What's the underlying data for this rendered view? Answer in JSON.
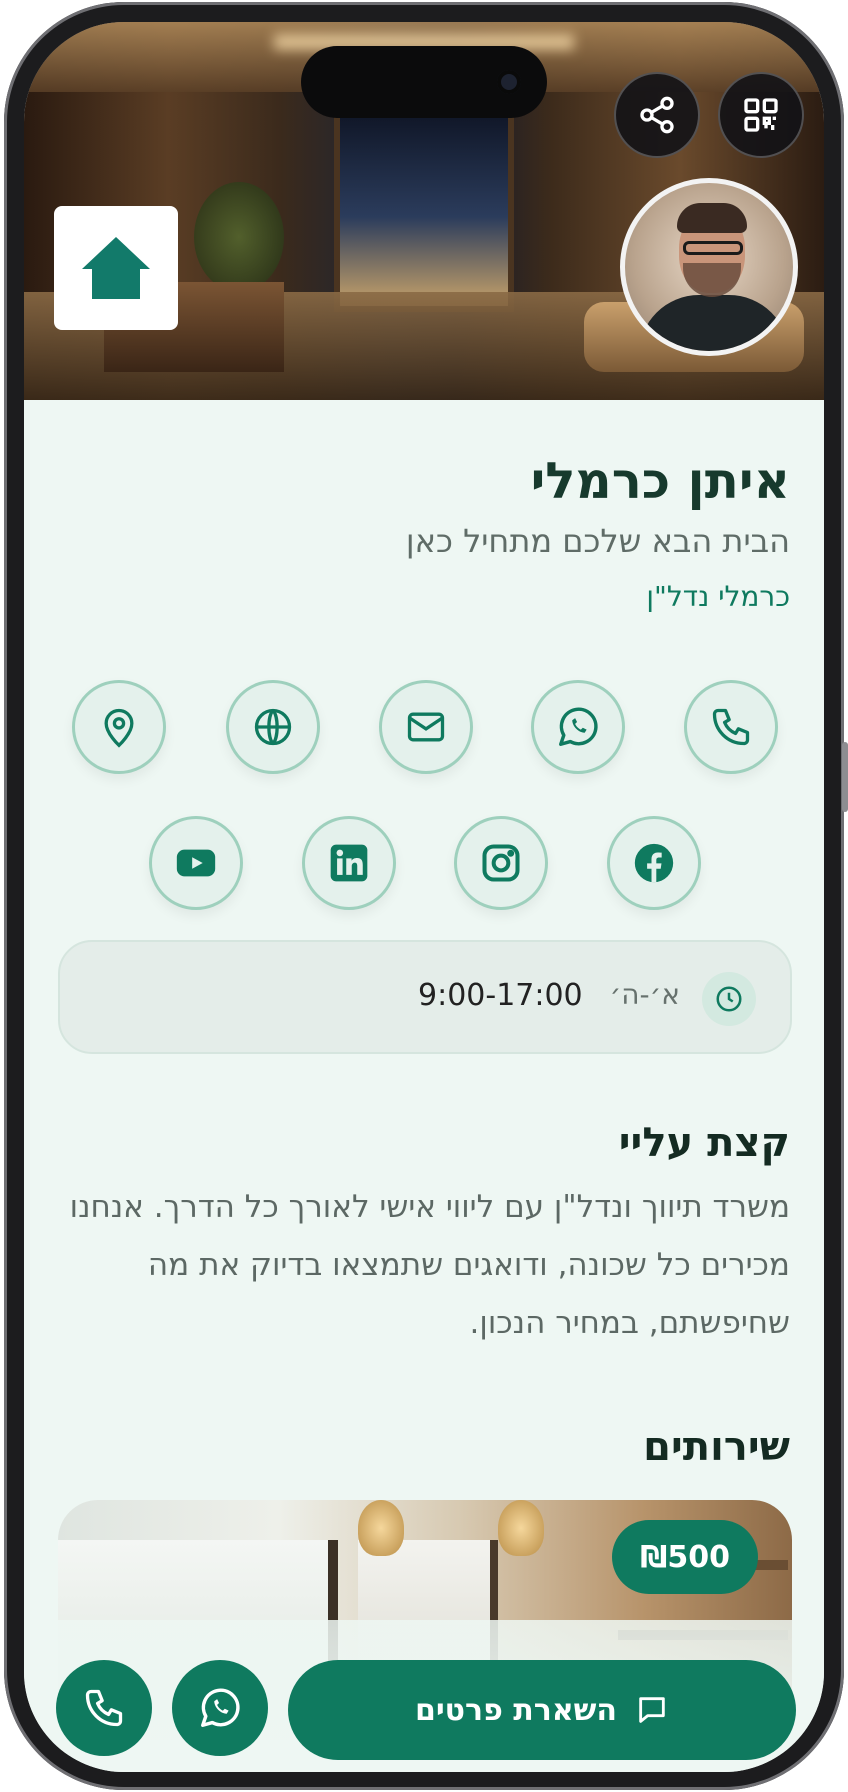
{
  "profile": {
    "name": "איתן כרמלי",
    "tagline": "הבית הבא שלכם מתחיל כאן",
    "company": "כרמלי נדל\"ן"
  },
  "header": {
    "icons": [
      "share-icon",
      "qr-code-icon"
    ],
    "logo_icon": "house-icon"
  },
  "contact_icons": [
    "phone-icon",
    "whatsapp-icon",
    "email-icon",
    "website-icon",
    "location-icon"
  ],
  "social_icons": [
    "facebook-icon",
    "instagram-icon",
    "linkedin-icon",
    "youtube-icon"
  ],
  "hours": {
    "days": "א׳-ה׳",
    "time": "9:00-17:00"
  },
  "about": {
    "title": "קצת עליי",
    "text": "משרד תיווך ונדל\"ן עם ליווי אישי לאורך כל הדרך. אנחנו מכירים כל שכונה, ודואגים שתמצאו בדיוק את מה שחיפשתם, במחיר הנכון."
  },
  "services": {
    "title": "שירותים",
    "items": [
      {
        "price": "₪500"
      }
    ]
  },
  "bottom_bar": {
    "cta_label": "השארת פרטים"
  },
  "colors": {
    "accent": "#0f7a5f",
    "background": "#eef7f3",
    "title": "#173a2d"
  }
}
